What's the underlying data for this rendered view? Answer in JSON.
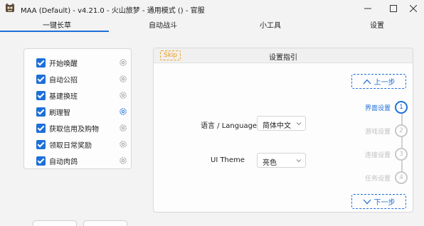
{
  "window": {
    "title": "MAA (Default) - v4.21.0 - 火山旅梦 - 通用模式 () - 官服",
    "icon": "app-icon",
    "controls": {
      "minimize": "—",
      "maximize": "☐",
      "close": "✕"
    }
  },
  "tabs": [
    {
      "label": "一键长草",
      "active": true
    },
    {
      "label": "自动战斗",
      "active": false
    },
    {
      "label": "小工具",
      "active": false
    },
    {
      "label": "设置",
      "active": false
    }
  ],
  "tasks": [
    {
      "label": "开始唤醒",
      "checked": true
    },
    {
      "label": "自动公招",
      "checked": true
    },
    {
      "label": "基建换班",
      "checked": true
    },
    {
      "label": "刷理智",
      "checked": true,
      "gear_active": true
    },
    {
      "label": "获取信用及购物",
      "checked": true
    },
    {
      "label": "领取日常奖励",
      "checked": true
    },
    {
      "label": "自动肉鸽",
      "checked": true
    }
  ],
  "guide": {
    "skip_label": "Skip",
    "title": "设置指引",
    "language_label": "语言 / Language",
    "language_value": "简体中文",
    "theme_label": "UI Theme",
    "theme_value": "亮色",
    "prev_label": "上一步",
    "next_label": "下一步",
    "steps": [
      {
        "label": "界面设置",
        "number": "1",
        "active": true
      },
      {
        "label": "游戏设置",
        "number": "2",
        "active": false
      },
      {
        "label": "连接设置",
        "number": "3",
        "active": false
      },
      {
        "label": "任务设置",
        "number": "4",
        "active": false
      }
    ]
  },
  "colors": {
    "accent": "#1e6fd9",
    "skip": "#e79a1d",
    "inactive": "#c0c0c0"
  }
}
